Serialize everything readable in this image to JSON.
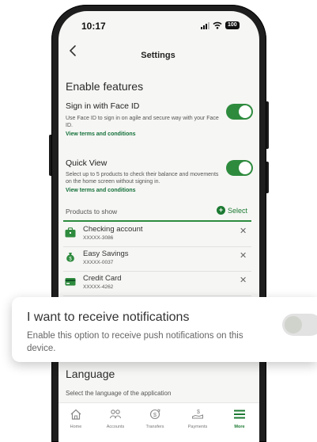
{
  "status_bar": {
    "time": "10:17",
    "battery": "100"
  },
  "header": {
    "title": "Settings"
  },
  "enable_features": {
    "title": "Enable features",
    "face_id": {
      "title": "Sign in with Face ID",
      "description": "Use Face ID to sign in on agile and secure way with your Face ID.",
      "link": "View terms and conditions",
      "enabled": true
    },
    "quick_view": {
      "title": "Quick View",
      "description": "Select up to 5 products to check their balance and movements on the home screen without signing in.",
      "link": "View terms and conditions",
      "enabled": true
    }
  },
  "products": {
    "label": "Products to show",
    "select_label": "Select",
    "items": [
      {
        "name": "Checking account",
        "number": "XXXXX-3086"
      },
      {
        "name": "Easy Savings",
        "number": "XXXXX-0037"
      },
      {
        "name": "Credit Card",
        "number": "XXXXX-4262"
      }
    ]
  },
  "notifications": {
    "title": "I want to receive notifications",
    "description": "Enable this option to receive push notifications on this device.",
    "enabled": false
  },
  "language": {
    "title": "Language",
    "description": "Select the language of the application"
  },
  "tabs": [
    {
      "label": "Home",
      "icon": "home-icon"
    },
    {
      "label": "Accounts",
      "icon": "accounts-icon"
    },
    {
      "label": "Transfers",
      "icon": "transfers-icon"
    },
    {
      "label": "Payments",
      "icon": "payments-icon"
    },
    {
      "label": "More",
      "icon": "menu-icon",
      "active": true
    }
  ],
  "colors": {
    "brand_green": "#2e8b3e",
    "link_green": "#14713a",
    "frame": "#1e1e1e"
  }
}
